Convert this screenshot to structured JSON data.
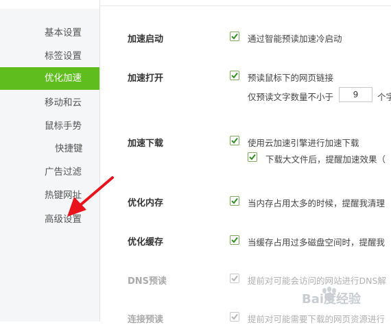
{
  "sidebar": {
    "items": [
      {
        "label": "基本设置"
      },
      {
        "label": "标签设置"
      },
      {
        "label": "优化加速"
      },
      {
        "label": "移动和云"
      },
      {
        "label": "鼠标手势"
      },
      {
        "label": "快捷键"
      },
      {
        "label": "广告过滤"
      },
      {
        "label": "热键网址"
      },
      {
        "label": "高级设置"
      }
    ],
    "active_index": 2,
    "active_color": "#5fbd1e"
  },
  "sections": {
    "startup": {
      "title": "加速启动",
      "opt1": {
        "label": "通过智能预读加速冷启动",
        "checked": true
      }
    },
    "open": {
      "title": "加速打开",
      "opt1": {
        "label": "预读鼠标下的网页链接",
        "checked": true
      },
      "min_chars_label": "仅预读文字数量不小于",
      "min_chars_value": "9",
      "min_chars_suffix": "个字"
    },
    "download": {
      "title": "加速下载",
      "opt1": {
        "label": "使用云加速引擎进行加速下载",
        "checked": true
      },
      "opt2": {
        "label": "下载大文件后，提醒加速效果（",
        "checked": true
      }
    },
    "memory": {
      "title": "优化内存",
      "opt1": {
        "label": "当内存占用太多的时候，提醒我清理",
        "checked": true
      }
    },
    "cache": {
      "title": "优化缓存",
      "opt1": {
        "label": "当缓存占用过多磁盘空间时，提醒我",
        "checked": true
      }
    },
    "dns": {
      "title": "DNS预读",
      "opt1": {
        "label": "提前对可能会访问的网站进行DNS解",
        "checked": true,
        "disabled": true
      }
    },
    "preconnect": {
      "title": "连接预读",
      "opt1": {
        "label": "提前对可能需要下载的网页资源进行",
        "checked": true,
        "disabled": true
      }
    }
  },
  "annotation": {
    "arrow_color": "#e8131b"
  },
  "watermark": {
    "text": "Bai度经验"
  }
}
